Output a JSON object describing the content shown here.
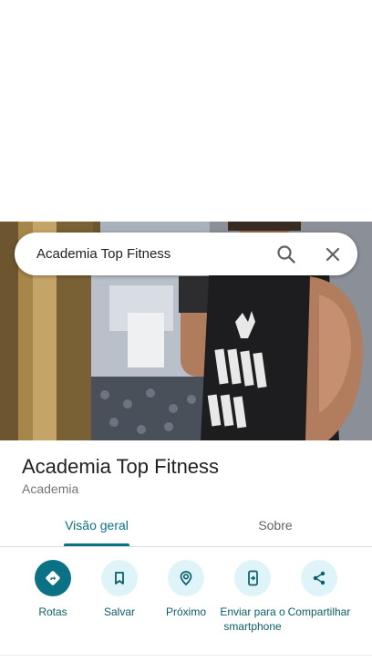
{
  "search": {
    "query": "Academia Top Fitness"
  },
  "place": {
    "title": "Academia Top Fitness",
    "category": "Academia"
  },
  "tabs": [
    {
      "label": "Visão geral",
      "active": true
    },
    {
      "label": "Sobre",
      "active": false
    }
  ],
  "actions": [
    {
      "label": "Rotas",
      "icon": "directions-icon"
    },
    {
      "label": "Salvar",
      "icon": "bookmark-icon"
    },
    {
      "label": "Próximo",
      "icon": "nearby-icon"
    },
    {
      "label": "Enviar para o smartphone",
      "icon": "send-to-phone-icon"
    },
    {
      "label": "Compartilhar",
      "icon": "share-icon"
    }
  ],
  "colors": {
    "accent": "#0b7285",
    "action_bg": "#dff4f8",
    "title_text": "#202124",
    "secondary_text": "#70757a"
  }
}
